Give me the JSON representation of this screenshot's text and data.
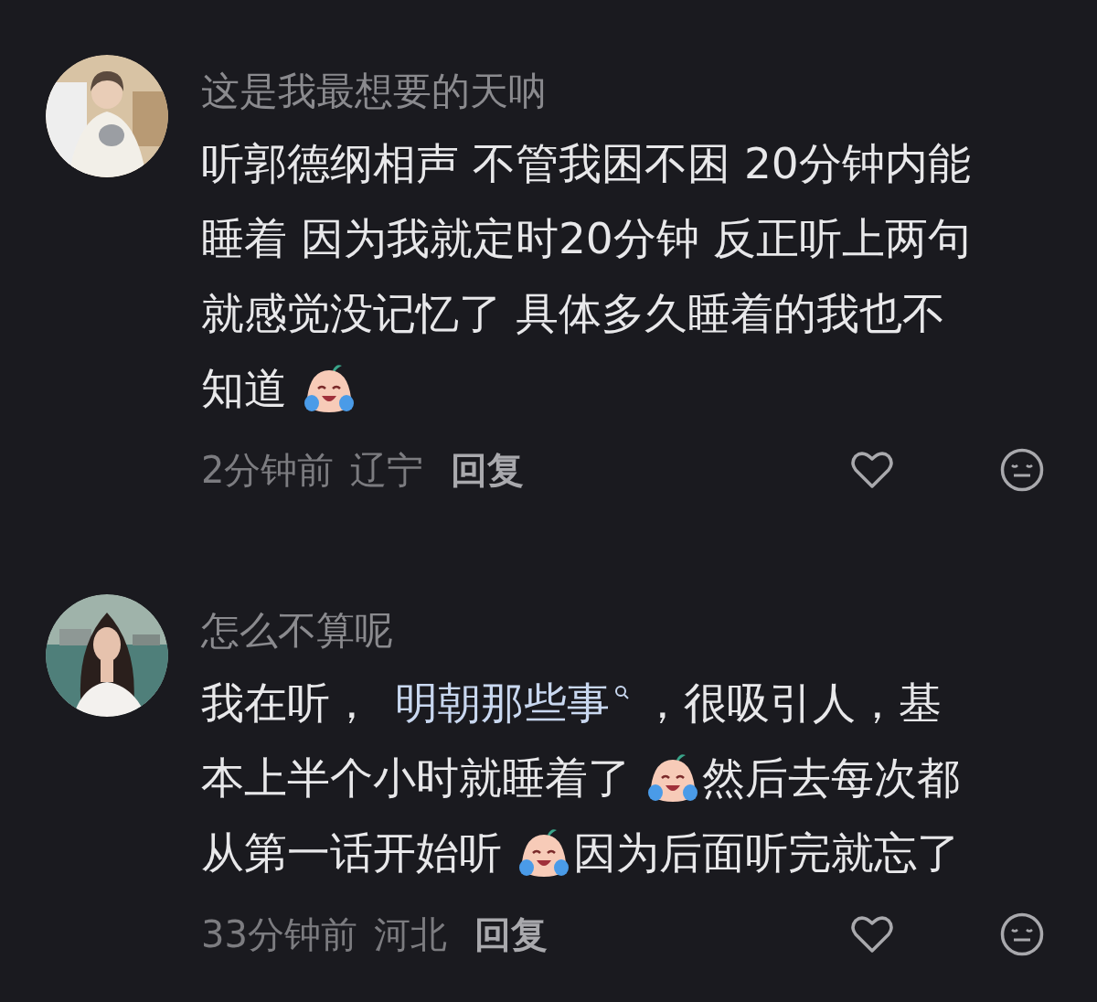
{
  "comments": [
    {
      "author": "这是我最想要的天呐",
      "avatar": {
        "kind": "picture"
      },
      "lines": [
        [
          {
            "kind": "text",
            "text": "听郭德纲相声 不管我困不困 20分钟内能"
          }
        ],
        [
          {
            "kind": "text",
            "text": "睡着 因为我就定时20分钟 反正听上两句"
          }
        ],
        [
          {
            "kind": "text",
            "text": "就感觉没记忆了 具体多久睡着的我也不"
          }
        ],
        [
          {
            "kind": "text",
            "text": "知道"
          },
          {
            "kind": "emoji"
          }
        ]
      ],
      "time": "2分钟前",
      "region": "辽宁",
      "reply": "回复"
    },
    {
      "author": "怎么不算呢",
      "avatar": {
        "kind": "picture"
      },
      "lines": [
        [
          {
            "kind": "text",
            "text": "我在听，"
          },
          {
            "kind": "link",
            "text": "明朝那些事"
          },
          {
            "kind": "text",
            "text": "，很吸引人，基"
          }
        ],
        [
          {
            "kind": "text",
            "text": "本上半个小时就睡着了"
          },
          {
            "kind": "emoji"
          },
          {
            "kind": "text",
            "text": "然后去每次都"
          }
        ],
        [
          {
            "kind": "text",
            "text": "从第一话开始听"
          },
          {
            "kind": "emoji"
          },
          {
            "kind": "text",
            "text": "因为后面听完就忘了"
          }
        ]
      ],
      "time": "33分钟前",
      "region": "河北",
      "reply": "回复"
    }
  ]
}
